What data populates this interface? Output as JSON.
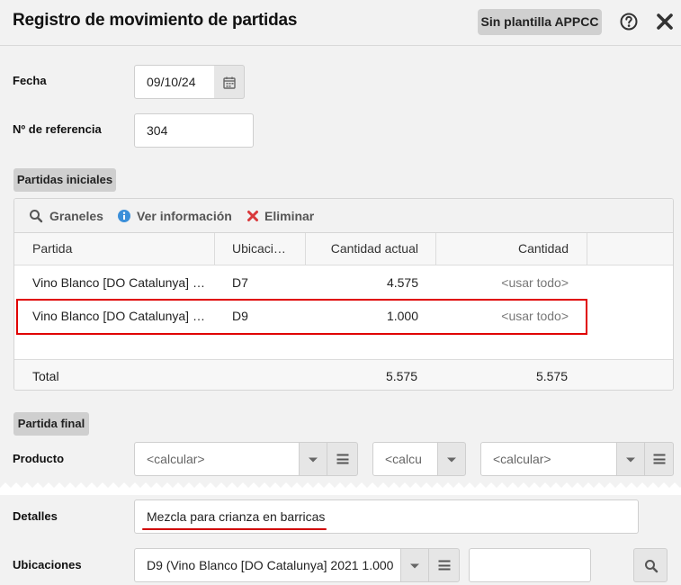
{
  "header": {
    "title": "Registro de movimiento de partidas",
    "badge": "Sin plantilla APPCC"
  },
  "form": {
    "fecha_label": "Fecha",
    "fecha_value": "09/10/24",
    "ref_label": "Nº de referencia",
    "ref_value": "304"
  },
  "partidas_iniciales": {
    "section_label": "Partidas iniciales",
    "toolbar": {
      "graneles": "Graneles",
      "ver_info": "Ver información",
      "eliminar": "Eliminar"
    },
    "columns": [
      "Partida",
      "Ubicaci…",
      "Cantidad actual",
      "Cantidad"
    ],
    "rows": [
      {
        "partida": "Vino Blanco [DO Catalunya] …",
        "ubicacion": "D7",
        "cantidad_actual": "4.575",
        "cantidad": "<usar todo>"
      },
      {
        "partida": "Vino Blanco [DO Catalunya] …",
        "ubicacion": "D9",
        "cantidad_actual": "1.000",
        "cantidad": "<usar todo>"
      }
    ],
    "total": {
      "label": "Total",
      "cantidad_actual": "5.575",
      "cantidad": "5.575"
    }
  },
  "partida_final": {
    "section_label": "Partida final",
    "producto_label": "Producto",
    "producto_value": "<calcular>",
    "combo2_value": "<calcu",
    "combo3_value": "<calcular>",
    "detalles_label": "Detalles",
    "detalles_value": "Mezcla para crianza en barricas",
    "ubicaciones_label": "Ubicaciones",
    "ubicaciones_value": "D9 (Vino Blanco [DO Catalunya] 2021 1.000"
  },
  "colors": {
    "highlight": "#e00000",
    "info_icon": "#3b8fd9",
    "delete_icon": "#d9383a"
  }
}
